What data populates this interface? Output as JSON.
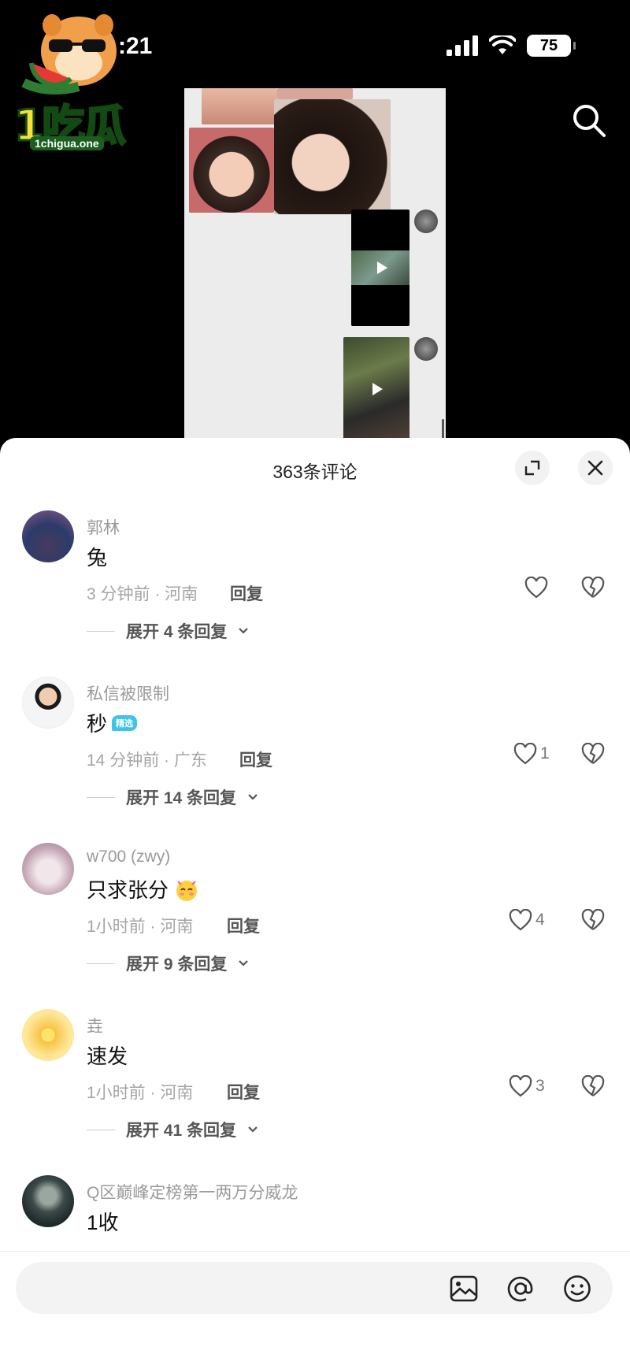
{
  "status_bar": {
    "time": ":21",
    "battery": "75"
  },
  "logo": {
    "brand": "1吃瓜",
    "url": "1chigua.one"
  },
  "icons": {
    "search": "search-icon",
    "expand": "expand-icon",
    "close": "close-icon",
    "heart": "heart-icon",
    "dislike": "broken-heart-icon",
    "chevron": "chevron-down-icon",
    "image": "image-icon",
    "at": "at-sign-icon",
    "emoji": "smiley-icon"
  },
  "sheet": {
    "title": "363条评论"
  },
  "comments": [
    {
      "user": "郭林",
      "text": "兔",
      "meta": "3 分钟前 · 河南",
      "reply": "回复",
      "likes": "",
      "expand": "展开 4 条回复"
    },
    {
      "user": "私信被限制",
      "text": "秒",
      "badge": "精选",
      "meta": "14 分钟前 · 广东",
      "reply": "回复",
      "likes": "1",
      "expand": "展开 14 条回复"
    },
    {
      "user": "w700 (zwy)",
      "text": "只求张分",
      "meta": "1小时前 · 河南",
      "reply": "回复",
      "likes": "4",
      "expand": "展开 9 条回复"
    },
    {
      "user": "垚",
      "text": "速发",
      "meta": "1小时前 · 河南",
      "reply": "回复",
      "likes": "3",
      "expand": "展开 41 条回复"
    },
    {
      "user": "Q区巅峰定榜第一两万分威龙",
      "text": "1收",
      "meta": "",
      "reply": "",
      "likes": "",
      "expand": ""
    }
  ],
  "input": {
    "placeholder": ""
  },
  "colors": {
    "sheet_bg": "#ffffff",
    "text_muted": "#9a9a9a",
    "badge": "#3ec3ec",
    "logo_green": "#1b5e20",
    "logo_yellow": "#f7e23a"
  }
}
